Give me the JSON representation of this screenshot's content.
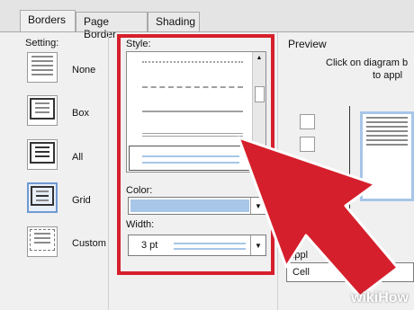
{
  "tabs": [
    {
      "label": "Borders",
      "underline": "B"
    },
    {
      "label": "Page Border",
      "underline": "P"
    },
    {
      "label": "Shading",
      "underline": "S"
    }
  ],
  "setting": {
    "title": "Setting:",
    "items": [
      "None",
      "Box",
      "All",
      "Grid",
      "Custom"
    ],
    "selected": "Grid"
  },
  "style": {
    "title": "Style:"
  },
  "color": {
    "title": "Color:",
    "value_color": "#a7c6e8"
  },
  "width": {
    "title": "Width:",
    "value": "3 pt"
  },
  "preview": {
    "title": "Preview",
    "hint_line1": "Click on diagram b",
    "hint_line2": "to appl"
  },
  "apply": {
    "title": "Appl",
    "value": "Cell"
  },
  "watermark": "wikiHow",
  "colors": {
    "highlight": "#d61f2c",
    "accent": "#6f9ad2"
  }
}
